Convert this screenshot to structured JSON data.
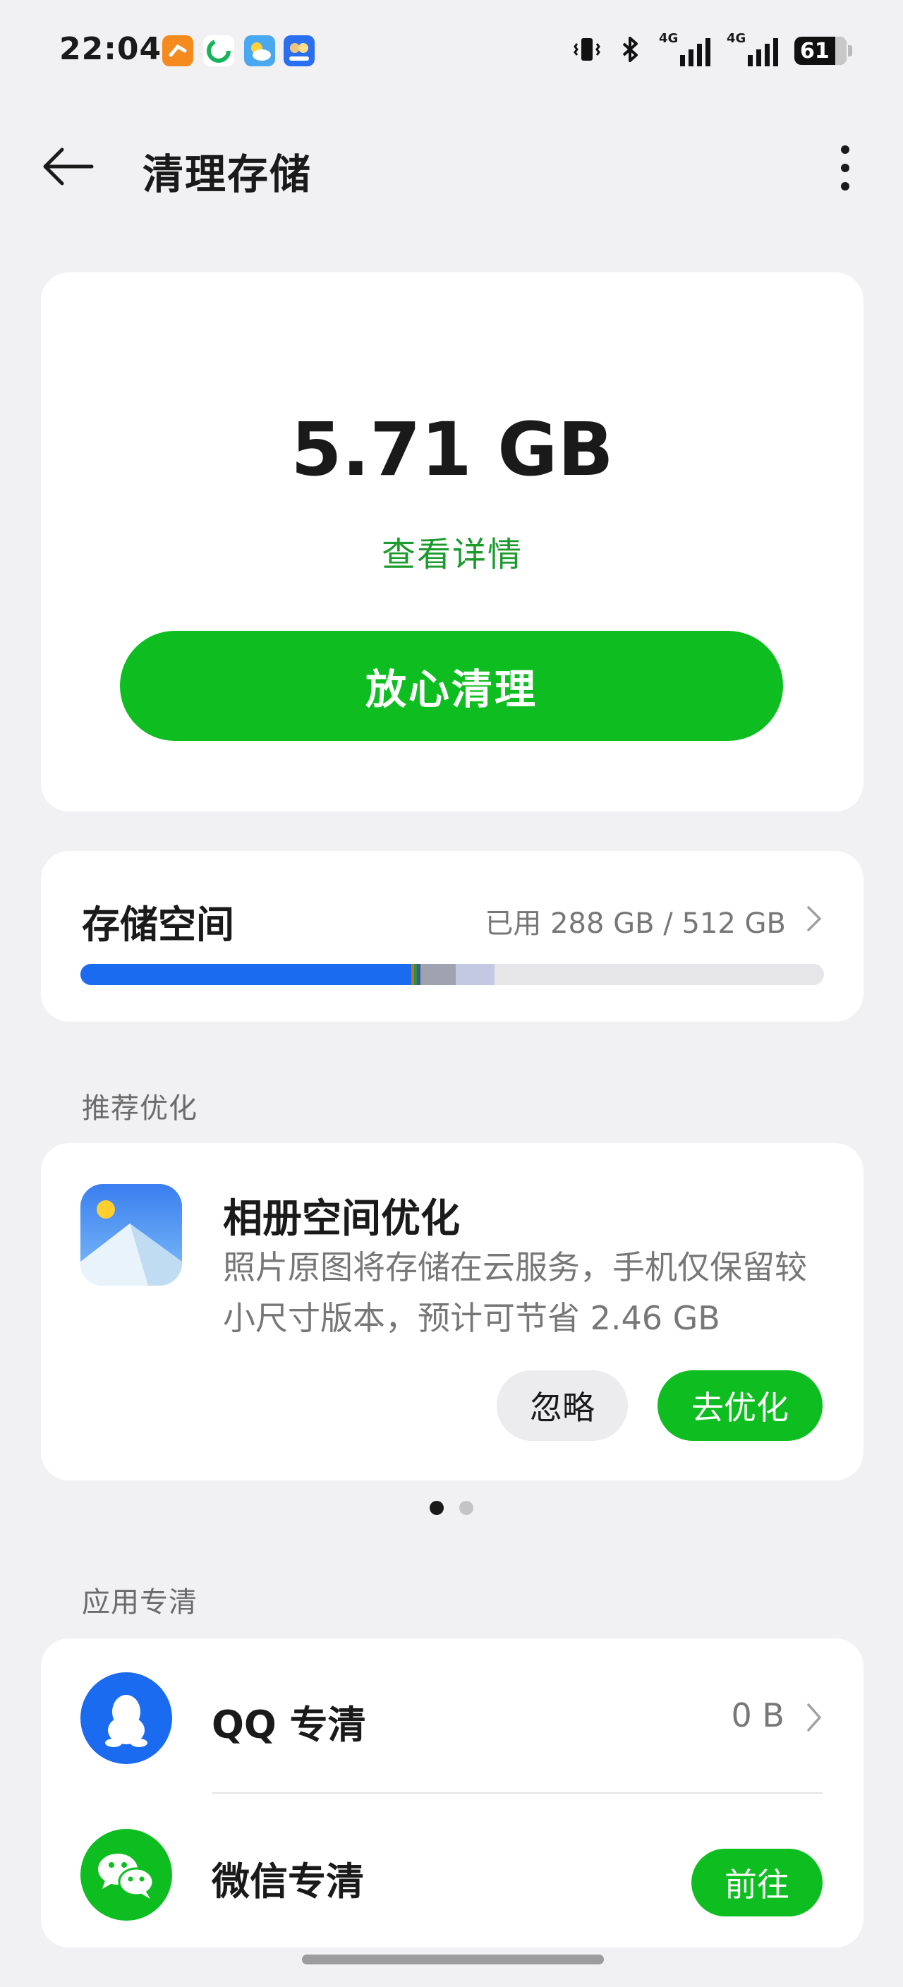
{
  "status_bar": {
    "time": "22:04",
    "network_label_1": "4G",
    "network_label_2": "4G",
    "battery_level": "61",
    "notification_icons": [
      "orange-app-icon",
      "green-app-icon",
      "weather-icon",
      "blue-app-icon"
    ]
  },
  "header": {
    "title": "清理存储"
  },
  "summary": {
    "junk_size": "5.71 GB",
    "details_link": "查看详情",
    "clean_button": "放心清理"
  },
  "storage": {
    "title": "存储空间",
    "usage": "已用 288 GB / 512 GB",
    "segments": [
      {
        "name": "primary",
        "fraction": 0.445,
        "color": "#1a6bf0"
      },
      {
        "name": "small-1",
        "fraction": 0.004,
        "color": "#b8791d"
      },
      {
        "name": "small-2",
        "fraction": 0.004,
        "color": "#2d8a4a"
      },
      {
        "name": "small-3",
        "fraction": 0.004,
        "color": "#3a5a8c"
      },
      {
        "name": "gray",
        "fraction": 0.048,
        "color": "#9fa3b0"
      },
      {
        "name": "lavender",
        "fraction": 0.052,
        "color": "#c4c9e3"
      }
    ]
  },
  "recommend": {
    "section_label": "推荐优化",
    "title": "相册空间优化",
    "description": "照片原图将存储在云服务，手机仅保留较小尺寸版本，预计可节省 2.46 GB",
    "ignore_button": "忽略",
    "optimize_button": "去优化",
    "page_index": 1,
    "page_count": 2
  },
  "app_clean": {
    "section_label": "应用专清",
    "items": [
      {
        "name": "QQ 专清",
        "size": "0 B"
      },
      {
        "name": "微信专清",
        "action": "前往"
      }
    ]
  },
  "colors": {
    "accent_green": "#0ebe20",
    "link_green": "#1d9a2e",
    "qq_blue": "#1a6bf0",
    "wechat_green": "#0ebe20"
  }
}
